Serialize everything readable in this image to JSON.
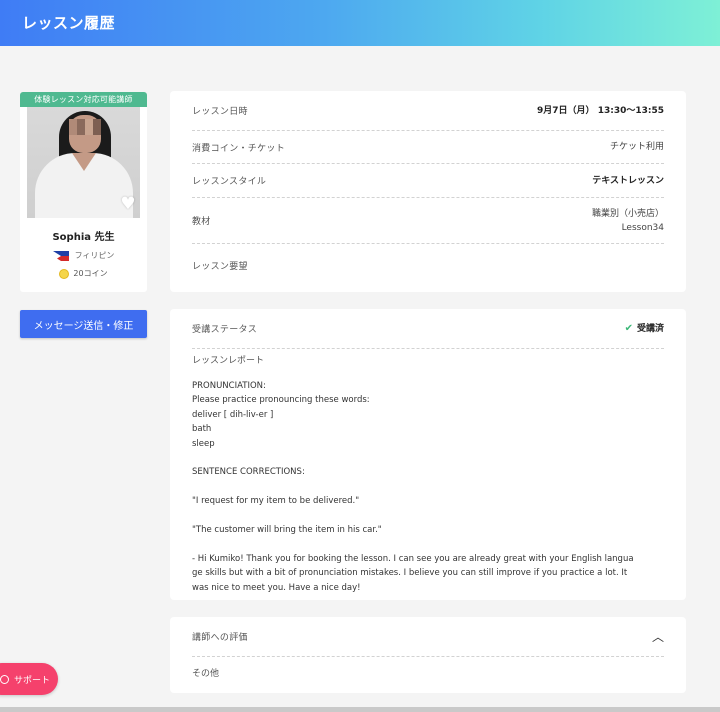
{
  "header": {
    "title": "レッスン履歴"
  },
  "teacher": {
    "trial_badge": "体験レッスン対応可能講師",
    "name": "Sophia 先生",
    "nationality": "フィリピン",
    "coins": "20コイン"
  },
  "actions": {
    "message_button": "メッセージ送信・修正"
  },
  "lesson_info": {
    "date_label": "レッスン日時",
    "date_value": "9月7日（月） 13:30～13:55",
    "cost_label": "消費コイン・チケット",
    "cost_value": "チケット利用",
    "style_label": "レッスンスタイル",
    "style_value": "テキストレッスン",
    "material_label": "教材",
    "material_value_1": "職業別（小売店）",
    "material_value_2": "Lesson34",
    "request_label": "レッスン要望"
  },
  "status": {
    "label": "受講ステータス",
    "value": "受講済",
    "report_label": "レッスンレポート",
    "report_text": "PRONUNCIATION:\nPlease practice pronouncing these words:\ndeliver [ dih-liv-er ]\nbath\nsleep\n\nSENTENCE CORRECTIONS:\n\n\"I request for my item to be delivered.\"\n\n\"The customer will bring the item in his car.\"\n\n- Hi Kumiko! Thank you for booking the lesson. I can see you are already great with your English langua\nge skills but with a bit of pronunciation mistakes. I believe you can still improve if you practice a lot. It\nwas nice to meet you. Have a nice day!"
  },
  "evaluation": {
    "label": "講師への評価",
    "other": "その他"
  },
  "support": {
    "label": "サポート"
  },
  "colors": {
    "primary_button": "#3f6df0",
    "trial_badge": "#4fb990",
    "support_button": "#f5416c",
    "check": "#3cb878"
  }
}
